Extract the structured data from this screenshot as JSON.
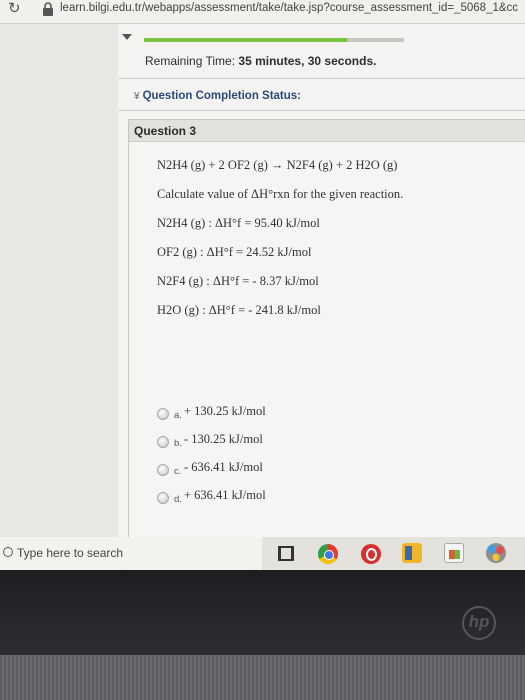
{
  "browser": {
    "url": "learn.bilgi.edu.tr/webapps/assessment/take/take.jsp?course_assessment_id=_5068_1&cc"
  },
  "assessment": {
    "progress_fraction": 0.78,
    "remaining_time_label": "Remaining Time:",
    "remaining_time_value": "35 minutes, 30 seconds.",
    "completion_status_label": "Question Completion Status:"
  },
  "question": {
    "title": "Question 3",
    "lines": [
      "N2H4 (g) + 2 OF2 (g) → N2F4 (g) + 2 H2O (g)",
      "Calculate value of ΔH°rxn for the given reaction.",
      "N2H4  (g) :  ΔH°f = 95.40 kJ/mol",
      "OF2  (g) :  ΔH°f = 24.52 kJ/mol",
      "N2F4 (g)  :  ΔH°f  = - 8.37 kJ/mol",
      "H2O (g)   :  ΔH°f  = - 241.8 kJ/mol"
    ],
    "options": [
      {
        "letter": "a.",
        "text": "+ 130.25  kJ/mol"
      },
      {
        "letter": "b.",
        "text": "- 130.25  kJ/mol"
      },
      {
        "letter": "c.",
        "text": "- 636.41  kJ/mol"
      },
      {
        "letter": "d.",
        "text": "+ 636.41  kJ/mol"
      }
    ]
  },
  "taskbar": {
    "search_placeholder": "Type here to search",
    "icons": [
      "task-view-icon",
      "chrome-icon",
      "opera-icon",
      "file-explorer-icon",
      "store-icon",
      "paint-icon"
    ]
  },
  "device": {
    "brand_logo": "hp"
  }
}
